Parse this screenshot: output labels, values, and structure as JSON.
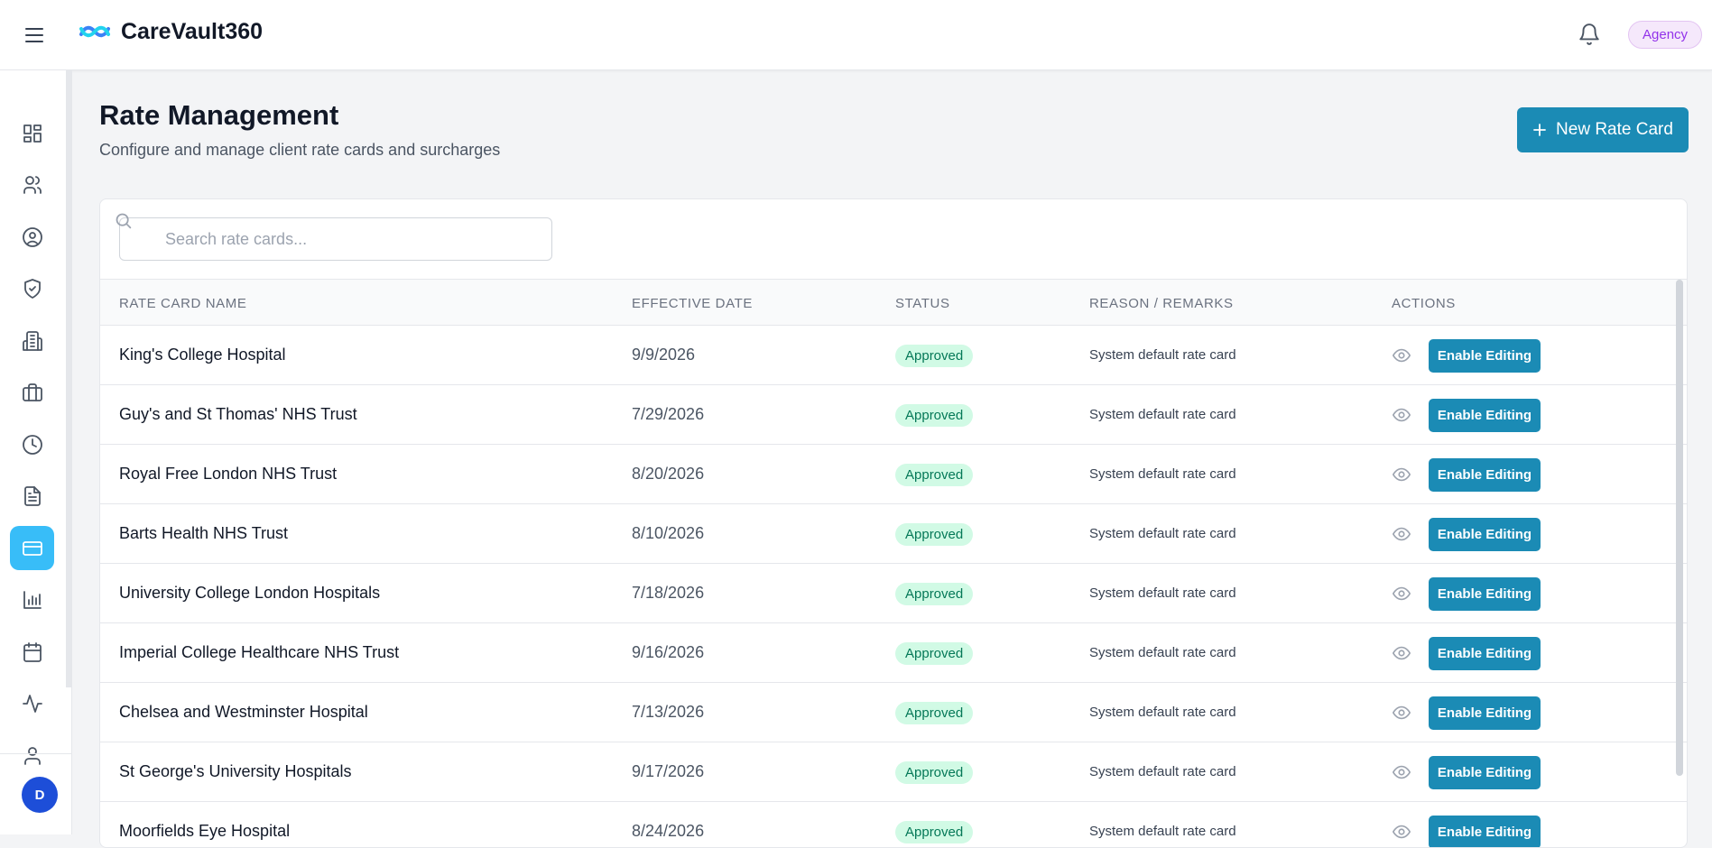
{
  "header": {
    "app_name": "CareVault360",
    "role_badge": "Agency"
  },
  "sidebar": {
    "items": [
      {
        "icon": "dashboard-icon"
      },
      {
        "icon": "users-icon"
      },
      {
        "icon": "user-circle-icon"
      },
      {
        "icon": "shield-check-icon"
      },
      {
        "icon": "building-icon"
      },
      {
        "icon": "briefcase-icon"
      },
      {
        "icon": "clock-icon"
      },
      {
        "icon": "document-icon"
      },
      {
        "icon": "credit-card-icon",
        "active": true
      },
      {
        "icon": "bar-chart-icon"
      },
      {
        "icon": "calendar-icon"
      },
      {
        "icon": "activity-icon"
      },
      {
        "icon": "user-icon"
      }
    ],
    "avatar_initial": "D"
  },
  "page": {
    "title": "Rate Management",
    "subtitle": "Configure and manage client rate cards and surcharges",
    "new_button_label": "New Rate Card"
  },
  "search": {
    "placeholder": "Search rate cards..."
  },
  "table": {
    "columns": [
      "RATE CARD NAME",
      "EFFECTIVE DATE",
      "STATUS",
      "REASON / REMARKS",
      "ACTIONS"
    ],
    "rows": [
      {
        "name": "King's College Hospital",
        "date": "9/9/2026",
        "status": "Approved",
        "reason": "System default rate card",
        "action": "Enable Editing"
      },
      {
        "name": "Guy's and St Thomas' NHS Trust",
        "date": "7/29/2026",
        "status": "Approved",
        "reason": "System default rate card",
        "action": "Enable Editing"
      },
      {
        "name": "Royal Free London NHS Trust",
        "date": "8/20/2026",
        "status": "Approved",
        "reason": "System default rate card",
        "action": "Enable Editing"
      },
      {
        "name": "Barts Health NHS Trust",
        "date": "8/10/2026",
        "status": "Approved",
        "reason": "System default rate card",
        "action": "Enable Editing"
      },
      {
        "name": "University College London Hospitals",
        "date": "7/18/2026",
        "status": "Approved",
        "reason": "System default rate card",
        "action": "Enable Editing"
      },
      {
        "name": "Imperial College Healthcare NHS Trust",
        "date": "9/16/2026",
        "status": "Approved",
        "reason": "System default rate card",
        "action": "Enable Editing"
      },
      {
        "name": "Chelsea and Westminster Hospital",
        "date": "7/13/2026",
        "status": "Approved",
        "reason": "System default rate card",
        "action": "Enable Editing"
      },
      {
        "name": "St George's University Hospitals",
        "date": "9/17/2026",
        "status": "Approved",
        "reason": "System default rate card",
        "action": "Enable Editing"
      },
      {
        "name": "Moorfields Eye Hospital",
        "date": "8/24/2026",
        "status": "Approved",
        "reason": "System default rate card",
        "action": "Enable Editing"
      }
    ]
  },
  "colors": {
    "primary": "#1b8bb5",
    "active_nav": "#38bdf8",
    "approved_bg": "#d1fae5",
    "approved_text": "#047857",
    "role_badge_text": "#9333ea"
  }
}
